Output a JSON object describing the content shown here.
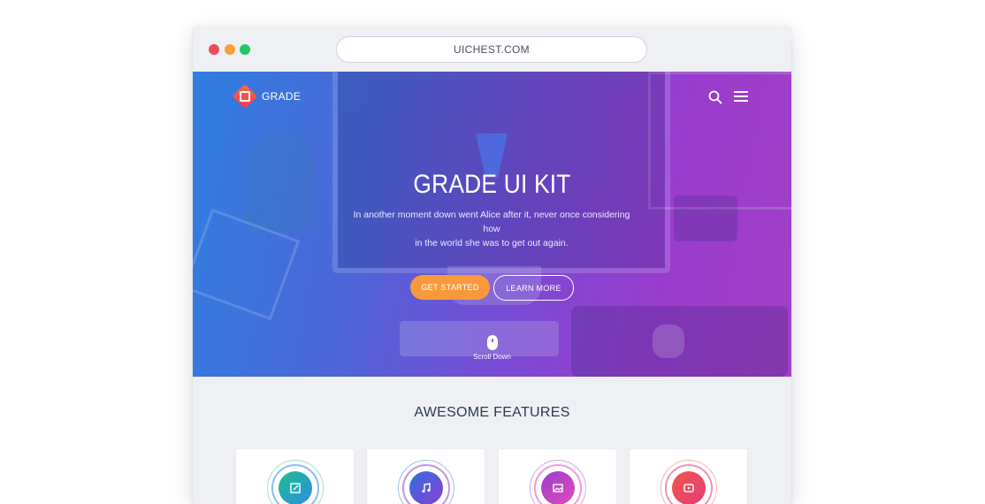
{
  "browser": {
    "url": "UICHEST.COM",
    "traffic_lights": [
      "close-dot",
      "minimize-dot",
      "maximize-dot"
    ]
  },
  "header": {
    "brand": "GRADE",
    "icons": [
      "search-icon",
      "hamburger-menu-icon"
    ]
  },
  "hero": {
    "title": "GRADE UI KIT",
    "subtitle_line1": "In another moment down went Alice after it, never once considering how",
    "subtitle_line2": "in the world she was to get out again.",
    "primary_button": "GET STARTED",
    "secondary_button": "LEARN MORE",
    "scroll_label": "Scroll Down",
    "gradient": [
      "#2f7fe0",
      "#a23fc6"
    ]
  },
  "features": {
    "title": "AWESOME FEATURES",
    "cards": [
      {
        "icon": "edit-icon",
        "color_from": "#1fbf8f",
        "color_to": "#2a8fe0"
      },
      {
        "icon": "music-icon",
        "color_from": "#2f6fe0",
        "color_to": "#8a3fd4"
      },
      {
        "icon": "image-icon",
        "color_from": "#9b3fd0",
        "color_to": "#e04ab8"
      },
      {
        "icon": "play-icon",
        "color_from": "#f0574a",
        "color_to": "#e63b7a"
      }
    ]
  },
  "colors": {
    "accent_orange": "#f89a3c",
    "page_bg": "#eef0f4",
    "heading": "#2e3a4f"
  }
}
